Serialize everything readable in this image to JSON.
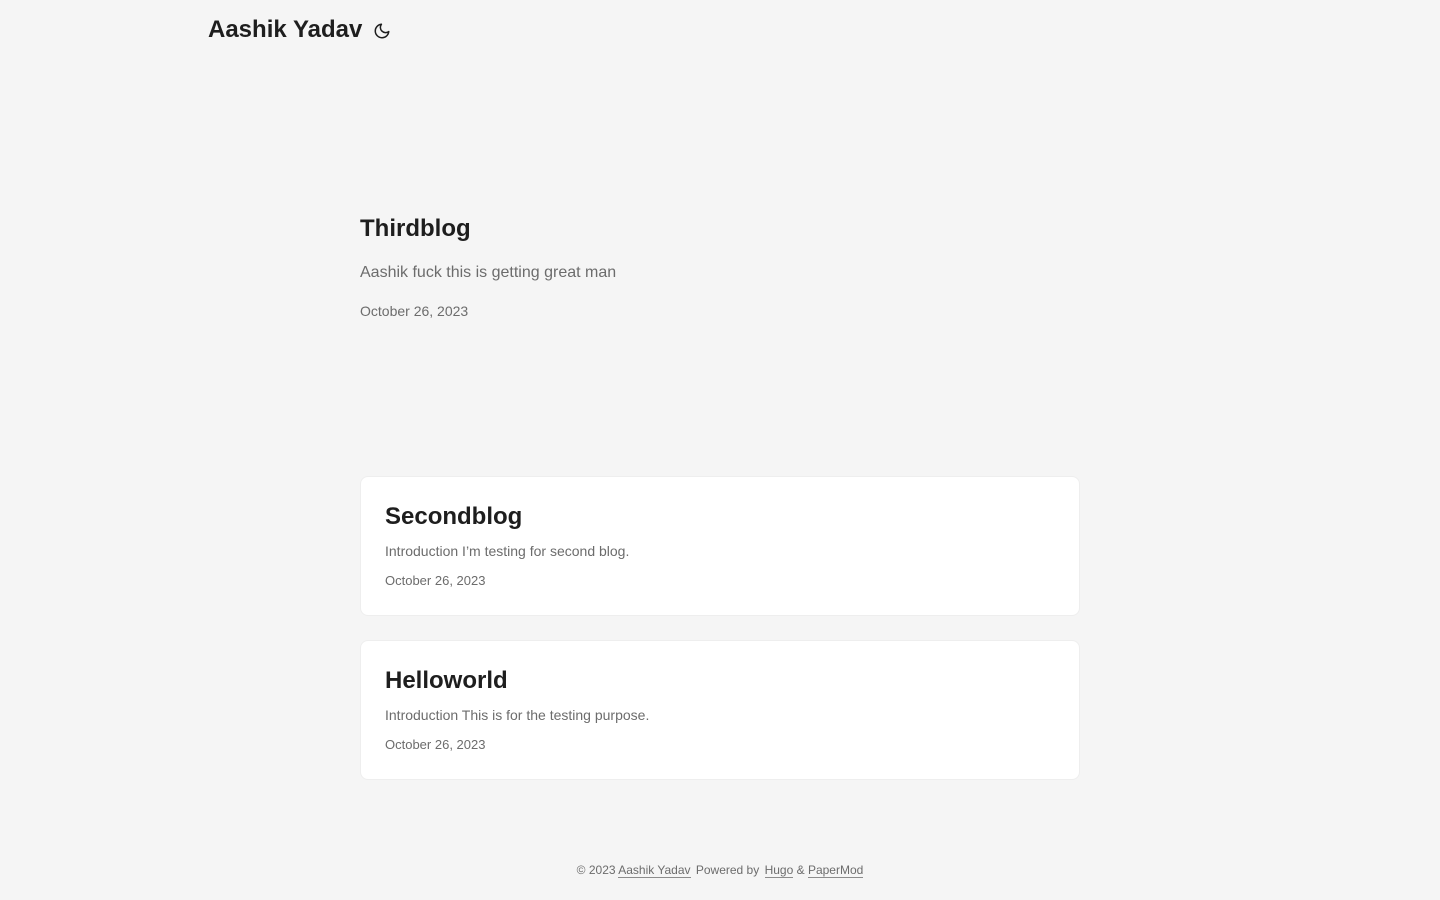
{
  "header": {
    "logo_text": "Aashik Yadav",
    "theme_toggle_icon": "moon-icon"
  },
  "first_entry": {
    "title": "Thirdblog",
    "summary": "Aashik fuck this is getting great man",
    "date": "October 26, 2023"
  },
  "posts": [
    {
      "title": "Secondblog",
      "summary": "Introduction I’m testing for second blog.",
      "date": "October 26, 2023"
    },
    {
      "title": "Helloworld",
      "summary": "Introduction This is for the testing purpose.",
      "date": "October 26, 2023"
    }
  ],
  "footer": {
    "copyright": "© 2023",
    "author_link": "Aashik Yadav",
    "powered_by": "Powered by",
    "hugo_link": "Hugo",
    "ampersand": "&",
    "papermod_link": "PaperMod"
  },
  "colors": {
    "background": "#f5f5f5",
    "card": "#ffffff",
    "primary_text": "#1e1e1e",
    "secondary_text": "#6c6c6c"
  }
}
